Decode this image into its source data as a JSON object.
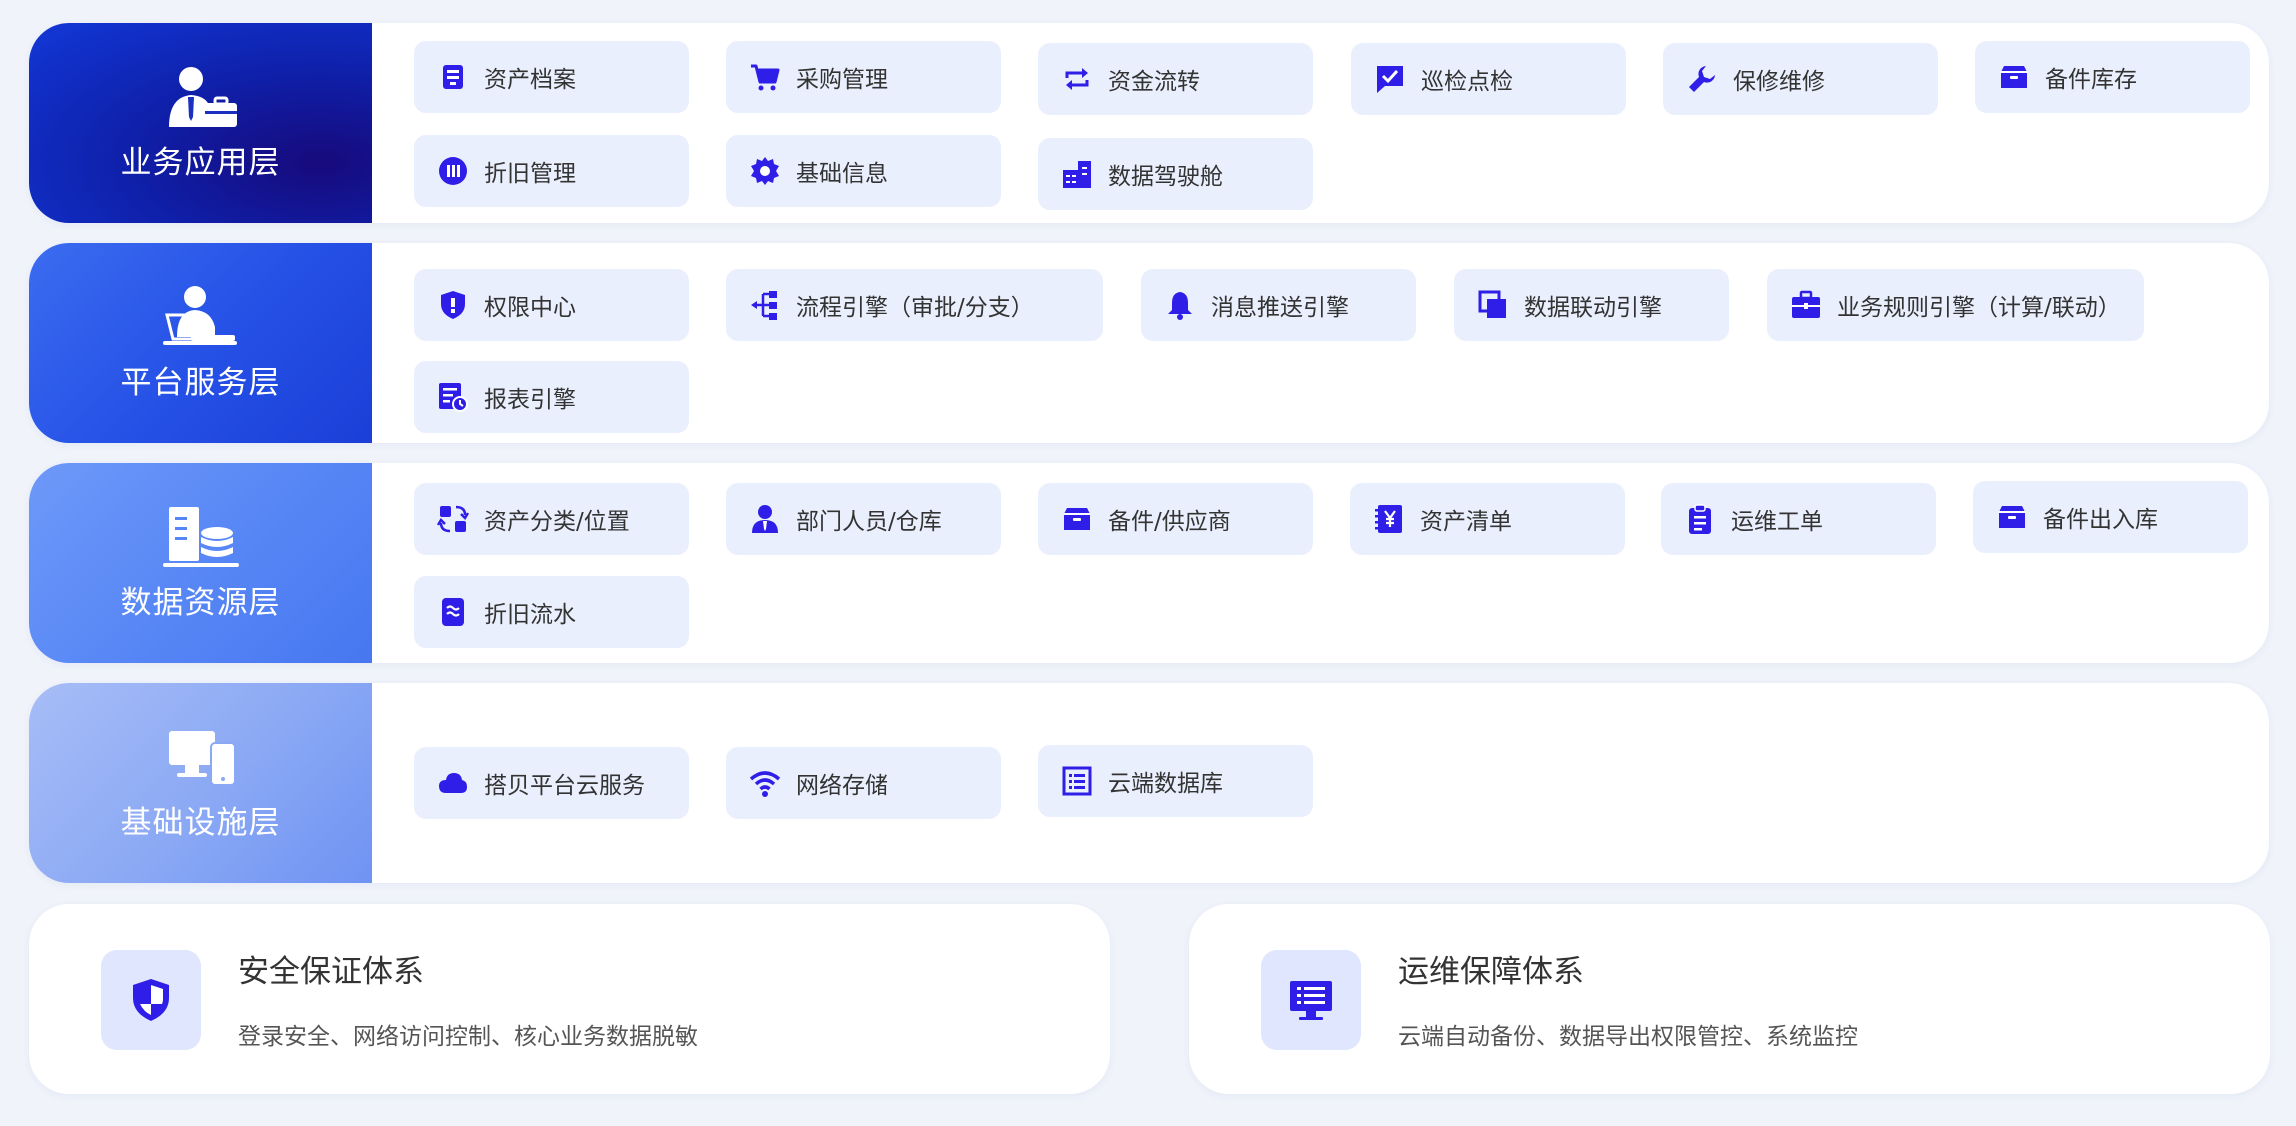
{
  "layers": [
    {
      "title": "业务应用层",
      "icon": "businessman-briefcase-icon",
      "items": [
        {
          "label": "资产档案",
          "icon": "archive-icon"
        },
        {
          "label": "采购管理",
          "icon": "shopping-cart-icon"
        },
        {
          "label": "资金流转",
          "icon": "repeat-arrows-icon"
        },
        {
          "label": "巡检点检",
          "icon": "check-chat-icon"
        },
        {
          "label": "保修维修",
          "icon": "wrench-icon"
        },
        {
          "label": "备件库存",
          "icon": "inventory-box-icon"
        },
        {
          "label": "折旧管理",
          "icon": "pause-circle-icon"
        },
        {
          "label": "基础信息",
          "icon": "gear-icon"
        },
        {
          "label": "数据驾驶舱",
          "icon": "dashboard-icon"
        }
      ]
    },
    {
      "title": "平台服务层",
      "icon": "person-laptop-icon",
      "items": [
        {
          "label": "权限中心",
          "icon": "shield-icon"
        },
        {
          "label": "流程引擎（审批/分支）",
          "icon": "flow-tree-icon"
        },
        {
          "label": "消息推送引擎",
          "icon": "bell-icon"
        },
        {
          "label": "数据联动引擎",
          "icon": "copy-stack-icon"
        },
        {
          "label": "业务规则引擎（计算/联动）",
          "icon": "briefcase-icon"
        },
        {
          "label": "报表引擎",
          "icon": "report-clock-icon"
        }
      ]
    },
    {
      "title": "数据资源层",
      "icon": "server-database-icon",
      "items": [
        {
          "label": "资产分类/位置",
          "icon": "category-swap-icon"
        },
        {
          "label": "部门人员/仓库",
          "icon": "person-icon"
        },
        {
          "label": "备件/供应商",
          "icon": "inventory-box-icon"
        },
        {
          "label": "资产清单",
          "icon": "ledger-yen-icon"
        },
        {
          "label": "运维工单",
          "icon": "clipboard-icon"
        },
        {
          "label": "备件出入库",
          "icon": "inventory-box-icon"
        },
        {
          "label": "折旧流水",
          "icon": "flow-wave-icon"
        }
      ]
    },
    {
      "title": "基础设施层",
      "icon": "monitor-phone-icon",
      "items": [
        {
          "label": "搭贝平台云服务",
          "icon": "cloud-icon"
        },
        {
          "label": "网络存储",
          "icon": "wifi-icon"
        },
        {
          "label": "云端数据库",
          "icon": "list-database-icon"
        }
      ]
    }
  ],
  "systems": [
    {
      "title": "安全保证体系",
      "desc": "登录安全、网络访问控制、核心业务数据脱敏",
      "icon": "security-shield-icon"
    },
    {
      "title": "运维保障体系",
      "desc": "云端自动备份、数据导出权限管控、系统监控",
      "icon": "monitor-list-icon"
    }
  ],
  "colors": {
    "accent": "#2f1ee8",
    "chip_bg": "#eaeffd",
    "page_bg": "#f0f3fa"
  }
}
